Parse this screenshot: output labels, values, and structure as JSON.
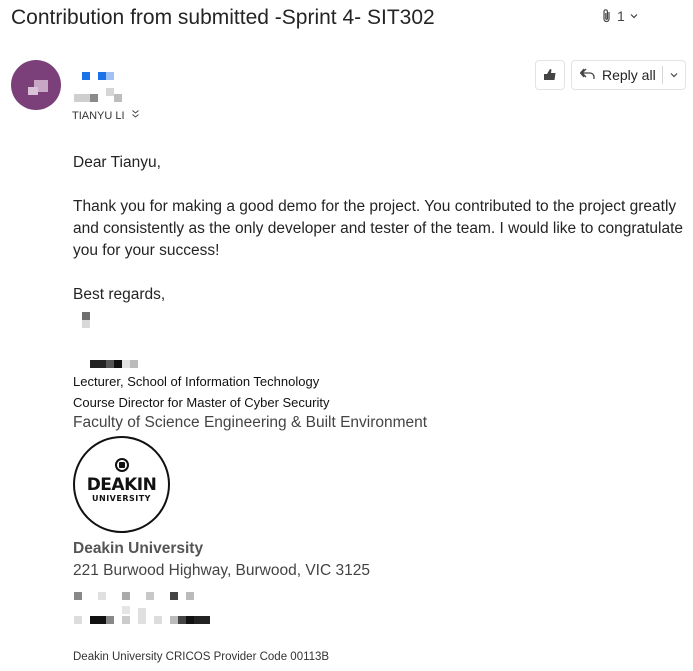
{
  "email": {
    "subject": "Contribution from submitted -Sprint 4- SIT302",
    "attachment_count": "1",
    "sender": {
      "to_label": "TIANYU LI"
    },
    "actions": {
      "reply_all_label": "Reply all"
    },
    "body": {
      "greeting": "Dear Tianyu,",
      "paragraph": "Thank you for making a good demo for the project. You contributed to the project greatly and consistently as the only developer and tester of the team. I would like to congratulate you for your success!",
      "closing": "Best regards,"
    },
    "signature": {
      "title": "Lecturer, School of Information Technology",
      "role": "Course Director for Master of Cyber Security",
      "faculty": "Faculty of Science Engineering & Built Environment",
      "logo_line1": "DEAKIN",
      "logo_line2": "UNIVERSITY",
      "university": "Deakin University",
      "address": "221 Burwood Highway, Burwood, VIC 3125",
      "cricos": "Deakin University CRICOS Provider Code 00113B"
    }
  },
  "colors": {
    "avatar": "#7b3f7a",
    "redacted_blue": "#1a73e8"
  }
}
